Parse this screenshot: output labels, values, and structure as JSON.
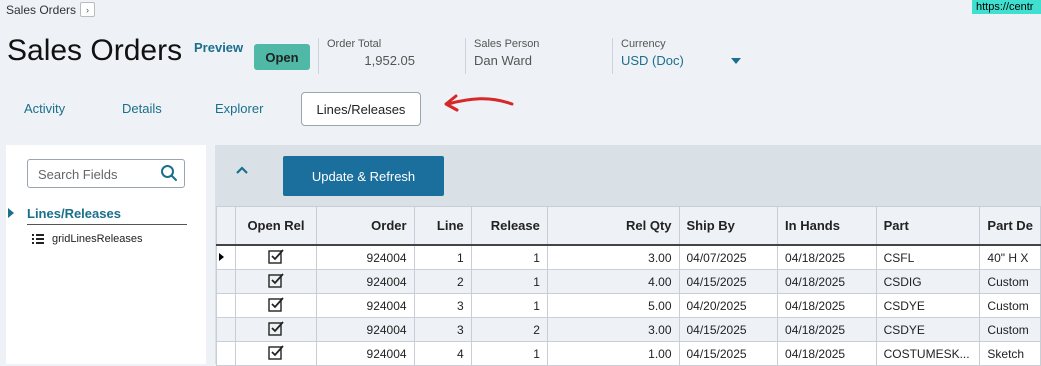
{
  "breadcrumb": {
    "label": "Sales Orders",
    "chevron": "›"
  },
  "url_chip": "https://centr",
  "header": {
    "title": "Sales Orders",
    "preview_label": "Preview",
    "status": "Open",
    "fields": [
      {
        "label": "Order Total",
        "value": "1,952.05"
      },
      {
        "label": "Sales Person",
        "value": "Dan Ward"
      },
      {
        "label": "Currency",
        "value": "USD (Doc)"
      }
    ]
  },
  "tabs": [
    "Activity",
    "Details",
    "Explorer",
    "Lines/Releases"
  ],
  "left": {
    "search_placeholder": "Search Fields",
    "tree_section": "Lines/Releases",
    "tree_item": "gridLinesReleases"
  },
  "toolbar": {
    "update_label": "Update & Refresh"
  },
  "grid": {
    "columns": [
      "Open Rel",
      "Order",
      "Line",
      "Release",
      "Rel Qty",
      "Ship By",
      "In Hands",
      "Part",
      "Part De"
    ],
    "rows": [
      {
        "order": "924004",
        "line": "1",
        "release": "1",
        "qty": "3.00",
        "ship": "04/07/2025",
        "hands": "04/18/2025",
        "part": "CSFL",
        "desc": "40\" H X"
      },
      {
        "order": "924004",
        "line": "2",
        "release": "1",
        "qty": "4.00",
        "ship": "04/15/2025",
        "hands": "04/18/2025",
        "part": "CSDIG",
        "desc": "Custom"
      },
      {
        "order": "924004",
        "line": "3",
        "release": "1",
        "qty": "5.00",
        "ship": "04/20/2025",
        "hands": "04/18/2025",
        "part": "CSDYE",
        "desc": "Custom"
      },
      {
        "order": "924004",
        "line": "3",
        "release": "2",
        "qty": "3.00",
        "ship": "04/15/2025",
        "hands": "04/18/2025",
        "part": "CSDYE",
        "desc": "Custom"
      },
      {
        "order": "924004",
        "line": "4",
        "release": "1",
        "qty": "1.00",
        "ship": "04/15/2025",
        "hands": "04/18/2025",
        "part": "COSTUMESK...",
        "desc": "Sketch"
      }
    ]
  },
  "colors": {
    "accent": "#1a6f8c",
    "badge": "#4fb8a6",
    "button": "#1a6f9c",
    "arrow": "#d62828"
  }
}
